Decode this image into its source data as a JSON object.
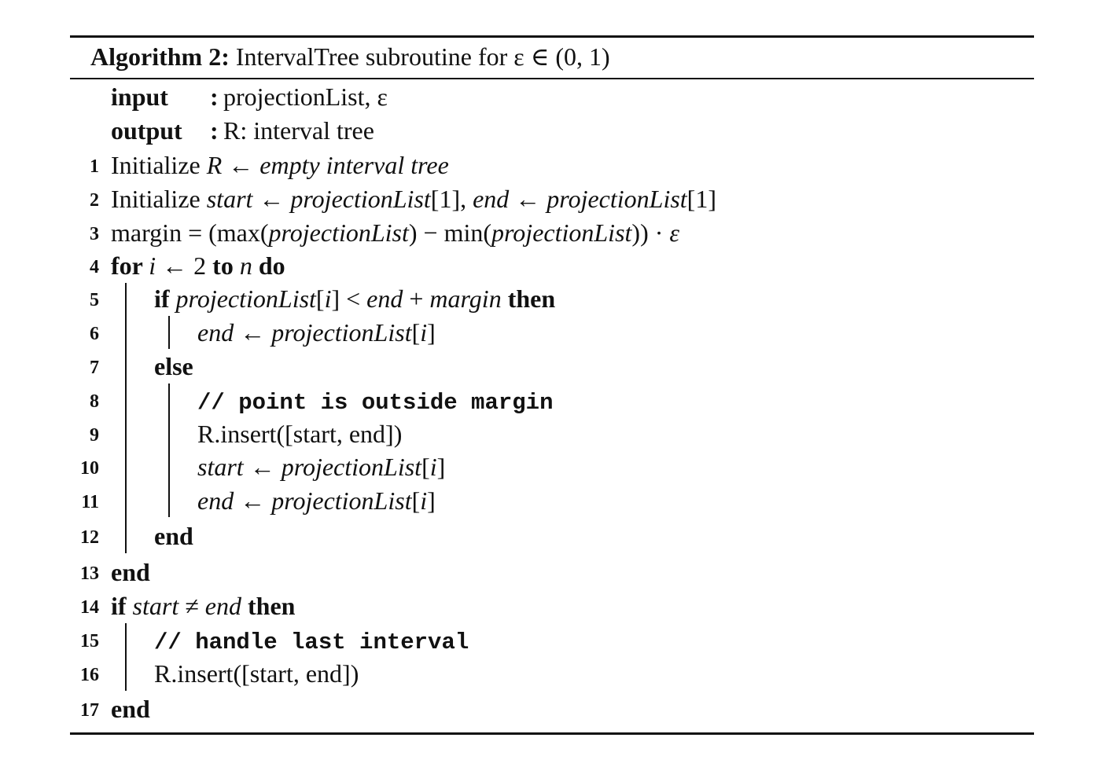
{
  "caption": {
    "label": "Algorithm 2:",
    "text": "IntervalTree subroutine for ε ∈ (0, 1)"
  },
  "io": {
    "input_label": "input",
    "input_value": "projectionList, ε",
    "output_label": "output",
    "output_value": "R: interval tree"
  },
  "lines": [
    {
      "num": "1",
      "indent": 0,
      "parts": [
        [
          "t",
          "Initialize "
        ],
        [
          "i",
          "R"
        ],
        [
          "t",
          " ← "
        ],
        [
          "i",
          "empty interval tree"
        ]
      ]
    },
    {
      "num": "2",
      "indent": 0,
      "parts": [
        [
          "t",
          "Initialize "
        ],
        [
          "i",
          "start"
        ],
        [
          "t",
          " ← "
        ],
        [
          "i",
          "projectionList"
        ],
        [
          "t",
          "[1], "
        ],
        [
          "i",
          "end"
        ],
        [
          "t",
          " ← "
        ],
        [
          "i",
          "projectionList"
        ],
        [
          "t",
          "[1]"
        ]
      ]
    },
    {
      "num": "3",
      "indent": 0,
      "parts": [
        [
          "t",
          "margin = (max("
        ],
        [
          "i",
          "projectionList"
        ],
        [
          "t",
          ") − min("
        ],
        [
          "i",
          "projectionList"
        ],
        [
          "t",
          ")) · "
        ],
        [
          "i",
          "ε"
        ]
      ]
    },
    {
      "num": "4",
      "indent": 0,
      "parts": [
        [
          "b",
          "for "
        ],
        [
          "i",
          "i"
        ],
        [
          "t",
          " ← 2 "
        ],
        [
          "b",
          "to "
        ],
        [
          "i",
          "n"
        ],
        [
          "b",
          " do"
        ]
      ]
    },
    {
      "num": "5",
      "indent": 1,
      "parts": [
        [
          "b",
          "if "
        ],
        [
          "i",
          "projectionList"
        ],
        [
          "t",
          "["
        ],
        [
          "i",
          "i"
        ],
        [
          "t",
          "] < "
        ],
        [
          "i",
          "end"
        ],
        [
          "t",
          " + "
        ],
        [
          "i",
          "margin"
        ],
        [
          "b",
          " then"
        ]
      ]
    },
    {
      "num": "6",
      "indent": 2,
      "parts": [
        [
          "i",
          "end"
        ],
        [
          "t",
          " ← "
        ],
        [
          "i",
          "projectionList"
        ],
        [
          "t",
          "["
        ],
        [
          "i",
          "i"
        ],
        [
          "t",
          "]"
        ]
      ]
    },
    {
      "num": "7",
      "indent": 1,
      "parts": [
        [
          "b",
          "else"
        ]
      ]
    },
    {
      "num": "8",
      "indent": 2,
      "parts": [
        [
          "m",
          "// point is outside margin"
        ]
      ]
    },
    {
      "num": "9",
      "indent": 2,
      "parts": [
        [
          "t",
          "R.insert([start, end])"
        ]
      ]
    },
    {
      "num": "10",
      "indent": 2,
      "parts": [
        [
          "i",
          "start"
        ],
        [
          "t",
          " ← "
        ],
        [
          "i",
          "projectionList"
        ],
        [
          "t",
          "["
        ],
        [
          "i",
          "i"
        ],
        [
          "t",
          "]"
        ]
      ]
    },
    {
      "num": "11",
      "indent": 2,
      "parts": [
        [
          "i",
          "end"
        ],
        [
          "t",
          " ← "
        ],
        [
          "i",
          "projectionList"
        ],
        [
          "t",
          "["
        ],
        [
          "i",
          "i"
        ],
        [
          "t",
          "]"
        ]
      ]
    },
    {
      "num": "12",
      "indent": 1,
      "parts": [
        [
          "b",
          "end"
        ]
      ]
    },
    {
      "num": "13",
      "indent": 0,
      "parts": [
        [
          "b",
          "end"
        ]
      ]
    },
    {
      "num": "14",
      "indent": 0,
      "parts": [
        [
          "b",
          "if "
        ],
        [
          "i",
          "start"
        ],
        [
          "t",
          " ≠ "
        ],
        [
          "i",
          "end"
        ],
        [
          "b",
          " then"
        ]
      ]
    },
    {
      "num": "15",
      "indent": 1,
      "parts": [
        [
          "m",
          "// handle last interval"
        ]
      ]
    },
    {
      "num": "16",
      "indent": 1,
      "parts": [
        [
          "t",
          "R.insert([start, end])"
        ]
      ]
    },
    {
      "num": "17",
      "indent": 0,
      "parts": [
        [
          "b",
          "end"
        ]
      ]
    }
  ]
}
